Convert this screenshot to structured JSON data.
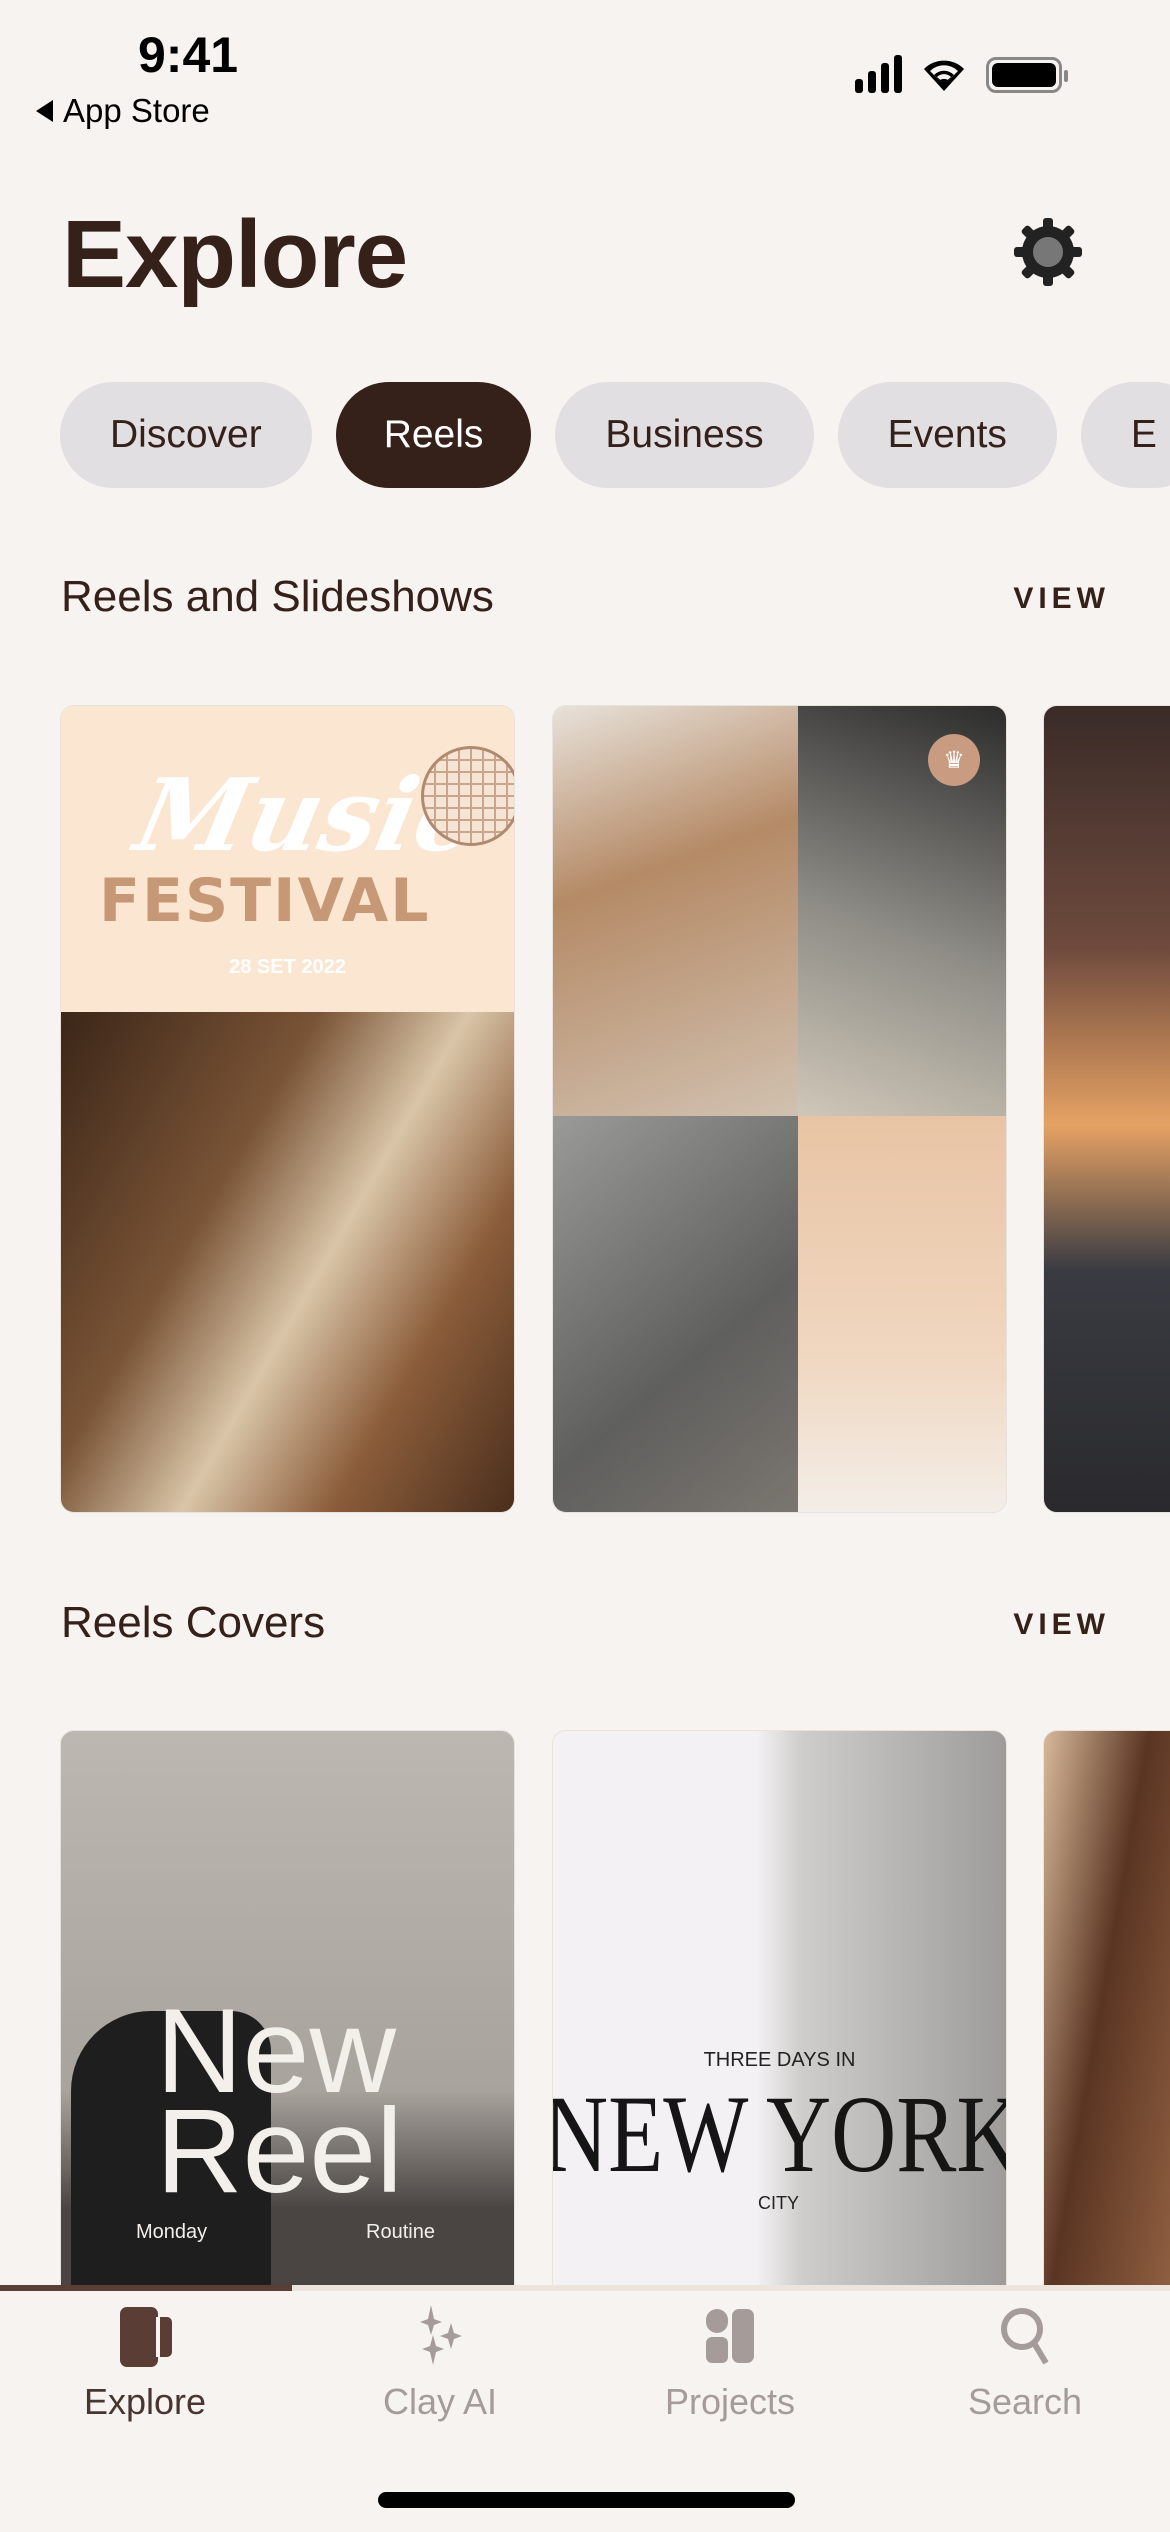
{
  "status_bar": {
    "time": "9:41",
    "back_label": "App Store",
    "icons": [
      "signal-icon",
      "wifi-icon",
      "battery-icon"
    ]
  },
  "header": {
    "title": "Explore",
    "settings_icon": "gear-icon"
  },
  "chips": [
    {
      "label": "Discover",
      "active": false
    },
    {
      "label": "Reels",
      "active": true
    },
    {
      "label": "Business",
      "active": false
    },
    {
      "label": "Events",
      "active": false
    },
    {
      "label": "E",
      "active": false
    }
  ],
  "sections": [
    {
      "title": "Reels and Slideshows",
      "view_label": "VIEW",
      "cards": [
        {
          "script": "Music",
          "headline": "FESTIVAL",
          "date": "28 SET 2022"
        },
        {
          "badge": "crown-icon"
        },
        {}
      ]
    },
    {
      "title": "Reels Covers",
      "view_label": "VIEW",
      "cards": [
        {
          "line1": "New",
          "line2": "Reel",
          "left": "Monday",
          "right": "Routine"
        },
        {
          "kicker": "THREE DAYS IN",
          "headline": "NEW YORK",
          "sub": "CITY"
        },
        {}
      ]
    }
  ],
  "tabbar": {
    "items": [
      {
        "label": "Explore",
        "icon": "explore-icon",
        "active": true
      },
      {
        "label": "Clay AI",
        "icon": "sparkles-icon",
        "active": false
      },
      {
        "label": "Projects",
        "icon": "projects-icon",
        "active": false
      },
      {
        "label": "Search",
        "icon": "search-icon",
        "active": false
      }
    ]
  },
  "colors": {
    "accent": "#35201a",
    "chip_bg": "#e2dfe3",
    "background": "#f6f3f0",
    "tab_inactive": "#a59c99"
  }
}
